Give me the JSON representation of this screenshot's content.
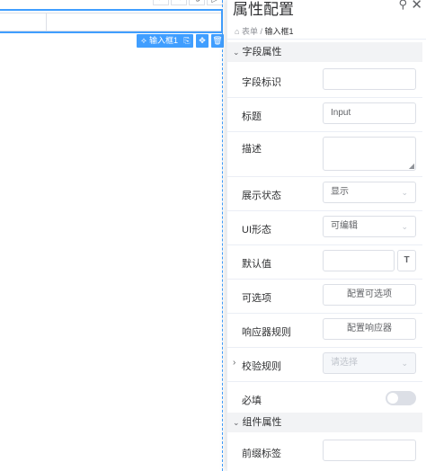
{
  "canvas": {
    "toolbar_icons": [
      "undo-icon",
      "redo-icon",
      "clear-icon",
      "preview-icon"
    ],
    "toolbar_glyphs": [
      "↶",
      "↷",
      "⟲",
      "▷"
    ],
    "field_tag": {
      "label": "输入框1",
      "icon": "component-icon"
    },
    "field_actions": [
      {
        "name": "copy-field-button",
        "glyph": "⎘"
      },
      {
        "name": "move-field-button",
        "glyph": "✥"
      },
      {
        "name": "delete-field-button",
        "glyph": "🗑"
      }
    ],
    "accent_color": "#409eff"
  },
  "panel": {
    "title": "属性配置",
    "pin_icon": "pin-icon",
    "close_icon": "close-icon",
    "breadcrumb": {
      "root_icon": "form-icon",
      "root": "表单",
      "separator": "/",
      "current": "输入框1"
    },
    "sections": {
      "field": "字段属性",
      "component": "组件属性"
    },
    "fields": {
      "field_id": {
        "label": "字段标识",
        "value": ""
      },
      "title": {
        "label": "标题",
        "value": "Input"
      },
      "description": {
        "label": "描述",
        "value": ""
      },
      "display_state": {
        "label": "展示状态",
        "value": "显示"
      },
      "ui_state": {
        "label": "UI形态",
        "value": "可编辑"
      },
      "default_value": {
        "label": "默认值",
        "value": "",
        "button": "T"
      },
      "options": {
        "label": "可选项",
        "button": "配置可选项"
      },
      "responder": {
        "label": "响应器规则",
        "button": "配置响应器"
      },
      "validation": {
        "label": "校验规则",
        "placeholder": "请选择"
      },
      "required": {
        "label": "必填",
        "on": false
      },
      "prefix": {
        "label": "前缀标签",
        "value": ""
      }
    }
  }
}
